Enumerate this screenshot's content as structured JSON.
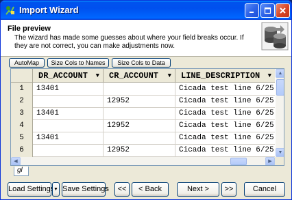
{
  "window": {
    "title": "Import Wizard"
  },
  "header": {
    "title": "File preview",
    "description": "The wizard has made some guesses about where your field breaks occur. If they are not correct, you can make adjustments now."
  },
  "toolbar": {
    "automap": "AutoMap",
    "size_names": "Size Cols to Names",
    "size_data": "Size Cols to Data"
  },
  "grid": {
    "columns": [
      "DR_ACCOUNT",
      "CR_ACCOUNT",
      "LINE_DESCRIPTION"
    ],
    "rows": [
      {
        "num": "1",
        "dr": "13401",
        "cr": "",
        "desc": "Cicada test line 6/25"
      },
      {
        "num": "2",
        "dr": "",
        "cr": "12952",
        "desc": "Cicada test line 6/25"
      },
      {
        "num": "3",
        "dr": "13401",
        "cr": "",
        "desc": "Cicada test line 6/25"
      },
      {
        "num": "4",
        "dr": "",
        "cr": "12952",
        "desc": "Cicada test line 6/25"
      },
      {
        "num": "5",
        "dr": "13401",
        "cr": "",
        "desc": "Cicada test line 6/25"
      },
      {
        "num": "6",
        "dr": "",
        "cr": "12952",
        "desc": "Cicada test line 6/25"
      }
    ],
    "sheet_tab": "gl"
  },
  "buttons": {
    "load_settings": "Load Settings",
    "save_settings": "Save Settings",
    "first": "<<",
    "back": "< Back",
    "next": "Next >",
    "last": ">>",
    "cancel": "Cancel"
  }
}
